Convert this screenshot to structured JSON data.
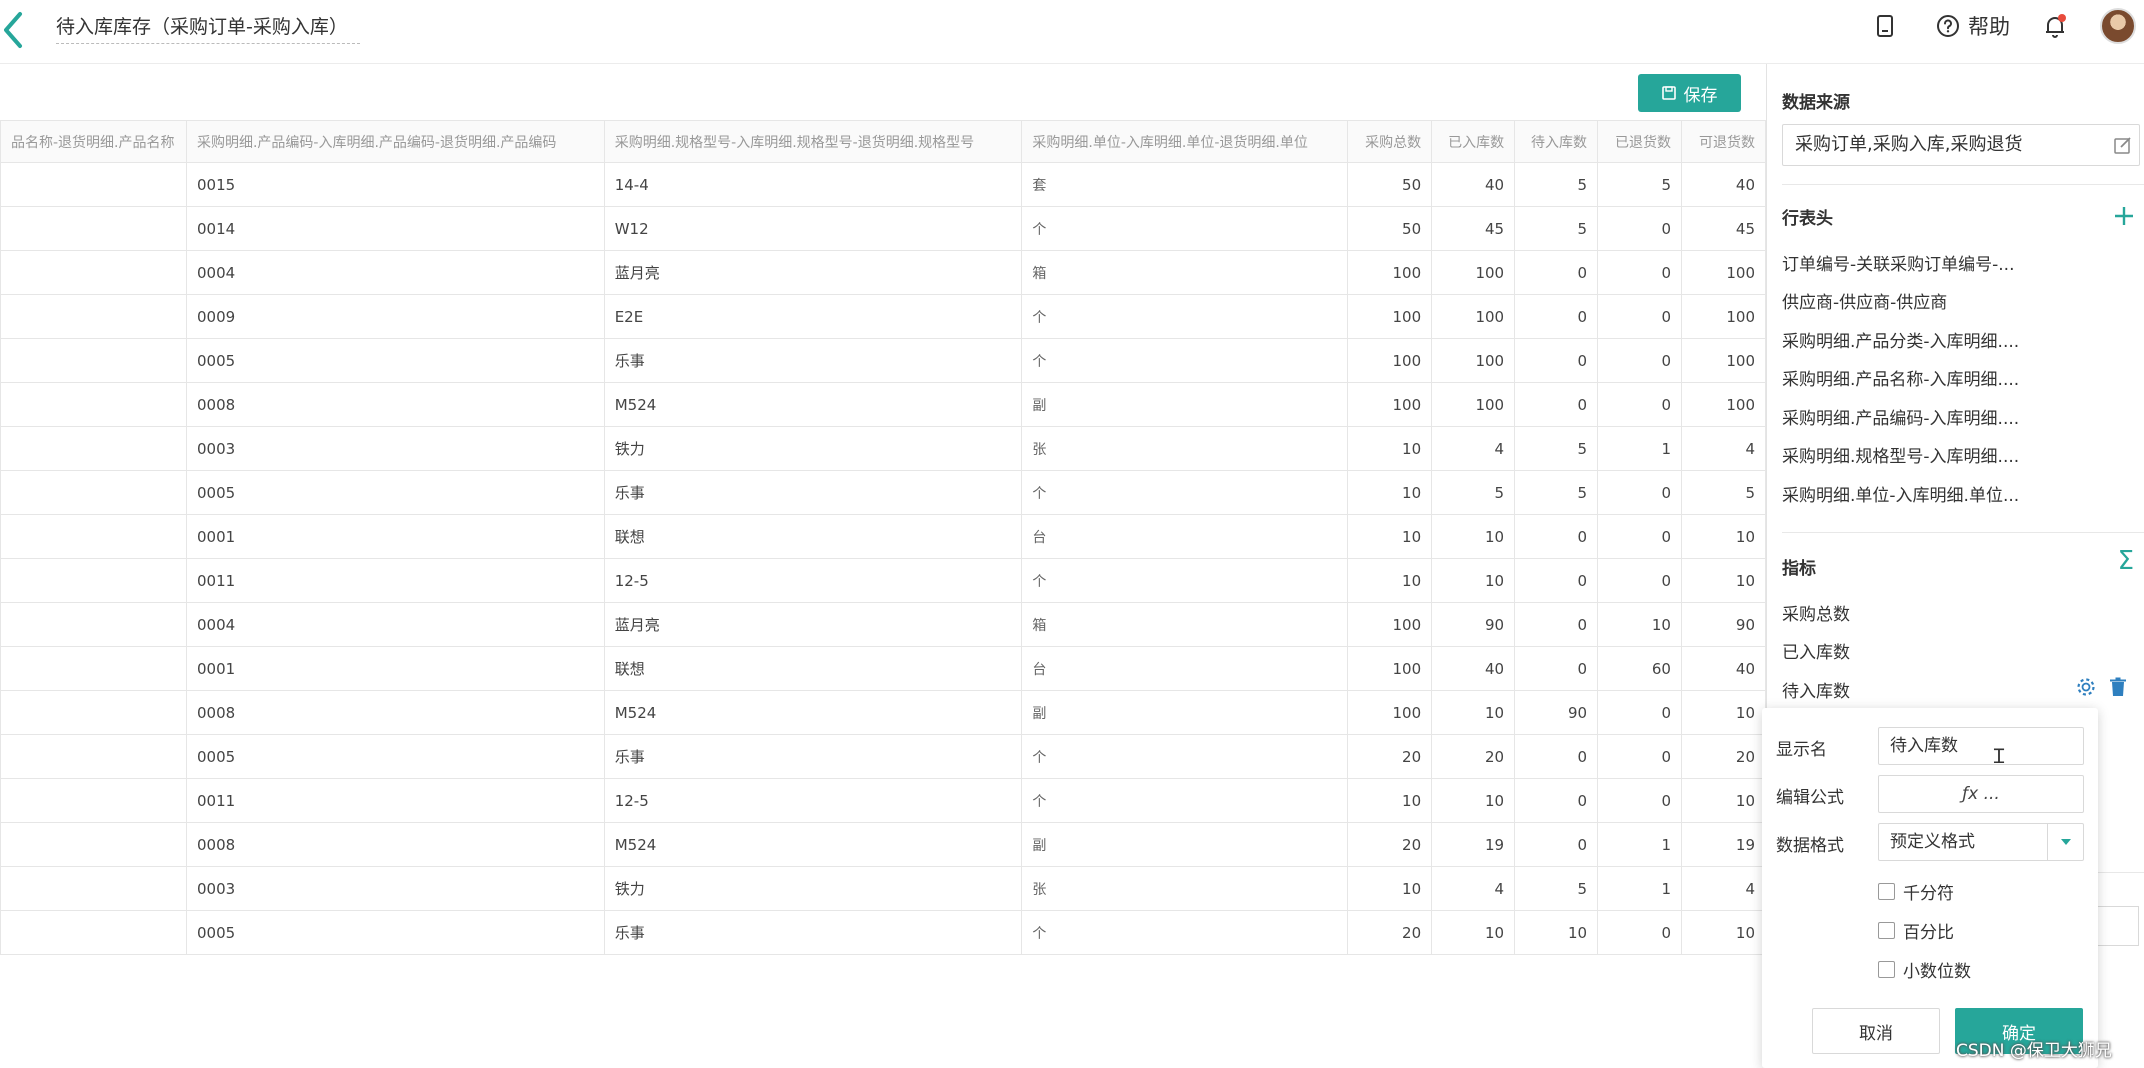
{
  "header": {
    "title": "待入库库存（采购订单-采购入库）",
    "help_label": "帮助"
  },
  "toolbar": {
    "save_label": "保存"
  },
  "table": {
    "columns": [
      "品名称-退货明细.产品名称",
      "采购明细.产品编码-入库明细.产品编码-退货明细.产品编码",
      "采购明细.规格型号-入库明细.规格型号-退货明细.规格型号",
      "采购明细.单位-入库明细.单位-退货明细.单位",
      "采购总数",
      "已入库数",
      "待入库数",
      "已退货数",
      "可退货数"
    ],
    "rows": [
      [
        "",
        "0015",
        "14-4",
        "套",
        "50",
        "40",
        "5",
        "5",
        "40"
      ],
      [
        "",
        "0014",
        "W12",
        "个",
        "50",
        "45",
        "5",
        "0",
        "45"
      ],
      [
        "",
        "0004",
        "蓝月亮",
        "箱",
        "100",
        "100",
        "0",
        "0",
        "100"
      ],
      [
        "",
        "0009",
        "E2E",
        "个",
        "100",
        "100",
        "0",
        "0",
        "100"
      ],
      [
        "",
        "0005",
        "乐事",
        "个",
        "100",
        "100",
        "0",
        "0",
        "100"
      ],
      [
        "",
        "0008",
        "M524",
        "副",
        "100",
        "100",
        "0",
        "0",
        "100"
      ],
      [
        "",
        "0003",
        "铁力",
        "张",
        "10",
        "4",
        "5",
        "1",
        "4"
      ],
      [
        "",
        "0005",
        "乐事",
        "个",
        "10",
        "5",
        "5",
        "0",
        "5"
      ],
      [
        "",
        "0001",
        "联想",
        "台",
        "10",
        "10",
        "0",
        "0",
        "10"
      ],
      [
        "",
        "0011",
        "12-5",
        "个",
        "10",
        "10",
        "0",
        "0",
        "10"
      ],
      [
        "",
        "0004",
        "蓝月亮",
        "箱",
        "100",
        "90",
        "0",
        "10",
        "90"
      ],
      [
        "",
        "0001",
        "联想",
        "台",
        "100",
        "40",
        "0",
        "60",
        "40"
      ],
      [
        "",
        "0008",
        "M524",
        "副",
        "100",
        "10",
        "90",
        "0",
        "10"
      ],
      [
        "",
        "0005",
        "乐事",
        "个",
        "20",
        "20",
        "0",
        "0",
        "20"
      ],
      [
        "",
        "0011",
        "12-5",
        "个",
        "10",
        "10",
        "0",
        "0",
        "10"
      ],
      [
        "",
        "0008",
        "M524",
        "副",
        "20",
        "19",
        "0",
        "1",
        "19"
      ],
      [
        "",
        "0003",
        "铁力",
        "张",
        "10",
        "4",
        "5",
        "1",
        "4"
      ],
      [
        "",
        "0005",
        "乐事",
        "个",
        "20",
        "10",
        "10",
        "0",
        "10"
      ]
    ]
  },
  "panel": {
    "data_source": {
      "title": "数据来源",
      "value": "采购订单,采购入库,采购退货"
    },
    "row_header": {
      "title": "行表头",
      "items": [
        "订单编号-关联采购订单编号-...",
        "供应商-供应商-供应商",
        "采购明细.产品分类-入库明细....",
        "采购明细.产品名称-入库明细....",
        "采购明细.产品编码-入库明细....",
        "采购明细.规格型号-入库明细....",
        "采购明细.单位-入库明细.单位..."
      ]
    },
    "metrics": {
      "title": "指标",
      "items": [
        "采购总数",
        "已入库数",
        "待入库数"
      ]
    }
  },
  "popover": {
    "display_name_label": "显示名",
    "display_name_value": "待入库数",
    "formula_label": "编辑公式",
    "formula_value": "ƒx ...",
    "format_label": "数据格式",
    "format_value": "预定义格式",
    "checkboxes": [
      "千分符",
      "百分比",
      "小数位数"
    ],
    "cancel_label": "取消",
    "ok_label": "确定"
  },
  "watermark": "CSDN @保卫大狮兄",
  "colors": {
    "accent": "#26a69a",
    "notification": "#e84b3c"
  }
}
